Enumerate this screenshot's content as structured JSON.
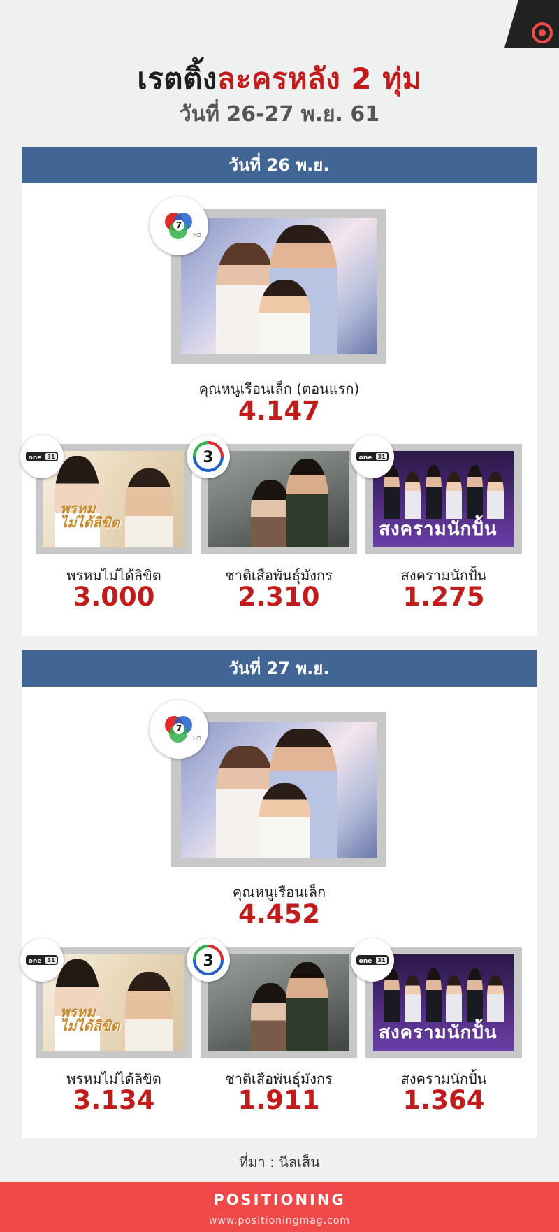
{
  "title_part1": "เรตติ้ง",
  "title_part2": "ละครหลัง 2 ทุ่ม",
  "subtitle": "วันที่ 26-27 พ.ย. 61",
  "days": [
    {
      "header": "วันที่ 26 พ.ย.",
      "main": {
        "channel": "ch7-logo",
        "name": "คุณหนูเรือนเล็ก (ตอนแรก)",
        "rating": "4.147"
      },
      "others": [
        {
          "channel": "one31-logo",
          "name": "พรหมไม่ได้ลิขิต",
          "rating": "3.000"
        },
        {
          "channel": "ch3-logo",
          "name": "ชาติเสือพันธุ์มังกร",
          "rating": "2.310"
        },
        {
          "channel": "one31-logo",
          "name": "สงครามนักปั้น",
          "rating": "1.275"
        }
      ]
    },
    {
      "header": "วันที่ 27 พ.ย.",
      "main": {
        "channel": "ch7-logo",
        "name": "คุณหนูเรือนเล็ก",
        "rating": "4.452"
      },
      "others": [
        {
          "channel": "one31-logo",
          "name": "พรหมไม่ได้ลิขิต",
          "rating": "3.134"
        },
        {
          "channel": "ch3-logo",
          "name": "ชาติเสือพันธุ์มังกร",
          "rating": "1.911"
        },
        {
          "channel": "one31-logo",
          "name": "สงครามนักปั้น",
          "rating": "1.364"
        }
      ]
    }
  ],
  "source": "ที่มา : นีลเส็น",
  "footer": {
    "brand": "POSITIONING",
    "url": "www.positioningmag.com"
  },
  "colors": {
    "accent_red": "#c21b1b",
    "header_blue": "#416696",
    "footer_red": "#f0494a"
  }
}
